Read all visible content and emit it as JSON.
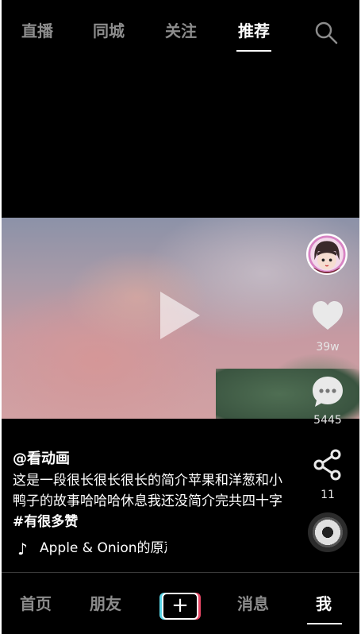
{
  "top_tabs": [
    {
      "label": "直播"
    },
    {
      "label": "同城"
    },
    {
      "label": "关注"
    },
    {
      "label": "推荐",
      "active": true
    }
  ],
  "actions": {
    "likes": "39w",
    "comments": "5445",
    "shares": "11"
  },
  "post": {
    "author": "@看动画",
    "description": "这是一段很长很长很长的简介苹果和洋葱和小鸭子的故事哈哈哈休息我还没简介完共四十字 ",
    "hashtag": "#有很多赞",
    "music": "Apple & Onion的原声"
  },
  "bottom_nav": [
    {
      "label": "首页"
    },
    {
      "label": "朋友"
    },
    {
      "label": "+"
    },
    {
      "label": "消息"
    },
    {
      "label": "我",
      "active": true
    }
  ],
  "colors": {
    "background": "#000000",
    "active_text": "#ffffff",
    "inactive_text": "#8c8c8c",
    "add_left": "#5bd6e8",
    "add_right": "#e94766"
  },
  "icons": [
    "search-icon",
    "play-icon",
    "heart-icon",
    "comment-icon",
    "share-icon",
    "music-disc-icon",
    "music-note-icon",
    "plus-icon"
  ]
}
